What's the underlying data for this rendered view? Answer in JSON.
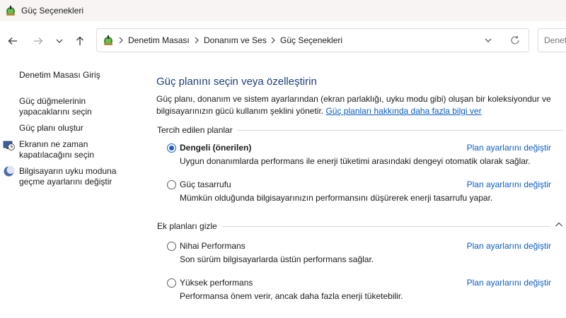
{
  "window": {
    "title": "Güç Seçenekleri"
  },
  "address": {
    "crumbs": [
      "Denetim Masası",
      "Donanım ve Ses",
      "Güç Seçenekleri"
    ],
    "search_placeholder": "Denet"
  },
  "sidebar": {
    "home": "Denetim Masası Giriş",
    "items": [
      {
        "lines": [
          "Güç düğmelerinin",
          "yapacaklarını seçin"
        ]
      },
      {
        "lines": [
          "Güç planı oluştur"
        ]
      },
      {
        "lines": [
          "Ekranın ne zaman",
          "kapatılacağını seçin"
        ],
        "icon": "monitor-clock-icon"
      },
      {
        "lines": [
          "Bilgisayarın uyku moduna",
          "geçme ayarlarını değiştir"
        ],
        "icon": "moon-icon"
      }
    ]
  },
  "main": {
    "title": "Güç planını seçin veya özelleştirin",
    "desc_line1": "Güç planı, donanım ve sistem ayarlarından (ekran parlaklığı, uyku modu gibi) oluşan bir koleksiyondur ve",
    "desc_line2": "bilgisayarınızın gücü kullanım şeklini yönetir.",
    "learn_more": "Güç planları hakkında daha fazla bilgi ver",
    "preferred_header": "Tercih edilen planlar",
    "extra_header": "Ek planları gizle",
    "change_link": "Plan ayarlarını değiştir",
    "plans": [
      {
        "name": "Dengeli (önerilen)",
        "desc": "Uygun donanımlarda performans ile enerji tüketimi arasındaki dengeyi otomatik olarak sağlar.",
        "selected": true
      },
      {
        "name": "Güç tasarrufu",
        "desc": "Mümkün olduğunda bilgisayarınızın performansını düşürerek enerji tasarrufu yapar.",
        "selected": false
      },
      {
        "name": "Nihai Performans",
        "desc": "Son sürüm bilgisayarlarda üstün performans sağlar.",
        "selected": false
      },
      {
        "name": "Yüksek performans",
        "desc": "Performansa önem verir, ancak daha fazla enerji tüketebilir.",
        "selected": false
      }
    ]
  },
  "colors": {
    "accent": "#1f5fbf",
    "link": "#0a5ec4",
    "title": "#1c3f7a"
  }
}
